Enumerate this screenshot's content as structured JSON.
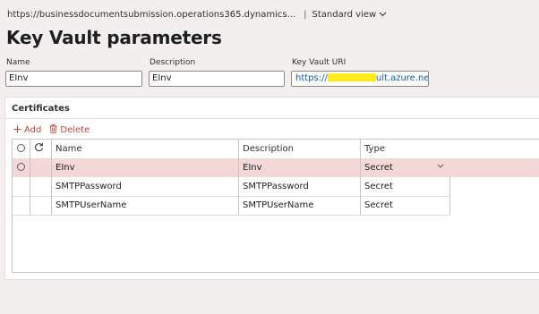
{
  "header": {
    "url": "https://businessdocumentsubmission.operations365.dynamics...",
    "separator": "|",
    "view_label": "Standard view",
    "page_title": "Key Vault parameters"
  },
  "form": {
    "name_label": "Name",
    "name_value": "EInv",
    "description_label": "Description",
    "description_value": "EInv",
    "uri_label": "Key Vault URI",
    "uri_prefix": "https://",
    "uri_suffix": "ult.azure.net/"
  },
  "certificates": {
    "title": "Certificates",
    "add_label": "Add",
    "delete_label": "Delete",
    "columns": [
      "Name",
      "Description",
      "Type"
    ],
    "rows": [
      {
        "name": "EInv",
        "description": "EInv",
        "type": "Secret"
      },
      {
        "name": "SMTPPassword",
        "description": "SMTPPassword",
        "type": "Secret"
      },
      {
        "name": "SMTPUserName",
        "description": "SMTPUserName",
        "type": "Secret"
      }
    ]
  },
  "icons": {
    "view_dropdown": "chevron-down-icon",
    "add": "plus-icon",
    "delete": "trash-icon",
    "select_all": "radio-circle-icon",
    "refresh": "refresh-icon",
    "type_dropdown": "chevron-down-icon"
  },
  "colors": {
    "accent_red": "#b44b3a",
    "selected_row": "#f2d9d7",
    "link": "#0f5aa8",
    "redaction": "#ffeb1a"
  }
}
